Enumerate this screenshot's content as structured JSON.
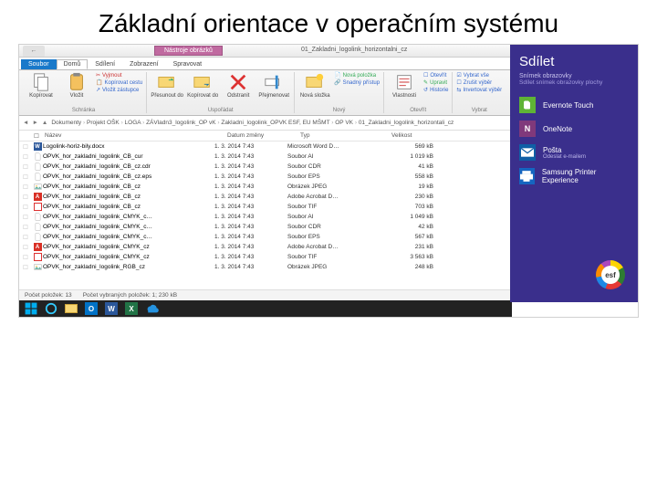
{
  "slide_title": "Základní orientace v operačním systému",
  "window_title": "01_Zakladni_logolink_horizontalni_cz",
  "contextual_tab": "Nástroje obrázků",
  "back_label": "←",
  "tabs": {
    "file": "Soubor",
    "home": "Domů",
    "share": "Sdílení",
    "view": "Zobrazení",
    "manage": "Spravovat"
  },
  "ribbon": {
    "g1": {
      "btn1": "Kopírovat",
      "btn2": "Vložit",
      "s1": "Vyjmout",
      "s2": "Kopírovat cestu",
      "s3": "Vložit zástupce",
      "label": "Schránka"
    },
    "g2": {
      "btn1": "Přesunout do",
      "btn2": "Kopírovat do",
      "btn3": "Odstranit",
      "btn4": "Přejmenovat",
      "label": "Uspořádat"
    },
    "g3": {
      "btn1": "Nová složka",
      "s1": "Nová položka",
      "s2": "Snadný přístup",
      "label": "Nový"
    },
    "g4": {
      "btn1": "Vlastnosti",
      "s1": "Otevřít",
      "s2": "Upravit",
      "s3": "Historie",
      "label": "Otevřít"
    },
    "g5": {
      "s1": "Vybrat vše",
      "s2": "Zrušit výběr",
      "s3": "Invertovat výběr",
      "label": "Vybrat"
    }
  },
  "breadcrumb": [
    "Dokumenty",
    "Projekt OŠK",
    "LOGA",
    "ZÁVladn3_logolink_OP vK",
    "Zakladni_logolink_OPVK ESF, EU MŠMT",
    "OP VK",
    "01_Zakladni_logolink_horizontali_cz"
  ],
  "columns": {
    "name": "Název",
    "date": "Datum změny",
    "type": "Typ",
    "size": "Velikost"
  },
  "files": [
    {
      "icon": "word",
      "name": "Logolink-horiz-bily.docx",
      "date": "1. 3. 2014 7:43",
      "type": "Microsoft Word D…",
      "size": "569 kB"
    },
    {
      "icon": "file",
      "name": "OPVK_hor_zakladni_logolink_CB_cur",
      "date": "1. 3. 2014 7:43",
      "type": "Soubor AI",
      "size": "1 019 kB"
    },
    {
      "icon": "file",
      "name": "OPVK_hor_zakladni_logolink_CB_cz.cdr",
      "date": "1. 3. 2014 7:43",
      "type": "Soubor CDR",
      "size": "41 kB"
    },
    {
      "icon": "file",
      "name": "OPVK_hor_zakladni_logolink_CB_cz.eps",
      "date": "1. 3. 2014 7:43",
      "type": "Soubor EPS",
      "size": "558 kB"
    },
    {
      "icon": "img",
      "name": "OPVK_hor_zakladni_logolink_CB_cz",
      "date": "1. 3. 2014 7:43",
      "type": "Obrázek JPEG",
      "size": "19 kB"
    },
    {
      "icon": "pdf",
      "name": "OPVK_hor_zakladni_logolink_CB_cz",
      "date": "1. 3. 2014 7:43",
      "type": "Adobe Acrobat D…",
      "size": "230 kB"
    },
    {
      "icon": "tif",
      "name": "OPVK_hor_zakladni_logolink_CB_cz",
      "date": "1. 3. 2014 7:43",
      "type": "Soubor TIF",
      "size": "703 kB"
    },
    {
      "icon": "file",
      "name": "OPVK_hor_zakladni_logolink_CMYK_c…",
      "date": "1. 3. 2014 7:43",
      "type": "Soubor AI",
      "size": "1 049 kB"
    },
    {
      "icon": "file",
      "name": "OPVK_hor_zakladni_logolink_CMYK_c…",
      "date": "1. 3. 2014 7:43",
      "type": "Soubor CDR",
      "size": "42 kB"
    },
    {
      "icon": "file",
      "name": "OPVK_hor_zakladni_logolink_CMYK_c…",
      "date": "1. 3. 2014 7:43",
      "type": "Soubor EPS",
      "size": "567 kB"
    },
    {
      "icon": "pdf",
      "name": "OPVK_hor_zakladni_logolink_CMYK_cz",
      "date": "1. 3. 2014 7:43",
      "type": "Adobe Acrobat D…",
      "size": "231 kB"
    },
    {
      "icon": "tif",
      "name": "OPVK_hor_zakladni_logolink_CMYK_cz",
      "date": "1. 3. 2014 7:43",
      "type": "Soubor TIF",
      "size": "3 563 kB"
    },
    {
      "icon": "img",
      "name": "OPVK_hor_zakladni_logolink_RGB_cz",
      "date": "1. 3. 2014 7:43",
      "type": "Obrázek JPEG",
      "size": "248 kB"
    }
  ],
  "statusbar": {
    "count": "Počet položek: 13",
    "selected": "Počet vybraných položek: 1; 230 kB"
  },
  "charm": {
    "title": "Sdílet",
    "sub1": "Snímek obrazovky",
    "sub2": "Sdílet snímek obrazovky plochy",
    "apps": [
      {
        "icon": "evernote",
        "label": "Evernote Touch",
        "color": "#5fb336"
      },
      {
        "icon": "onenote",
        "label": "OneNote",
        "color": "#80397b"
      },
      {
        "icon": "mail",
        "label": "Pošta",
        "sub": "Odeslat e-mailem",
        "color": "#0f5fa6"
      },
      {
        "icon": "printer",
        "label": "Samsung Printer Experience",
        "color": "#1565c0"
      }
    ]
  }
}
